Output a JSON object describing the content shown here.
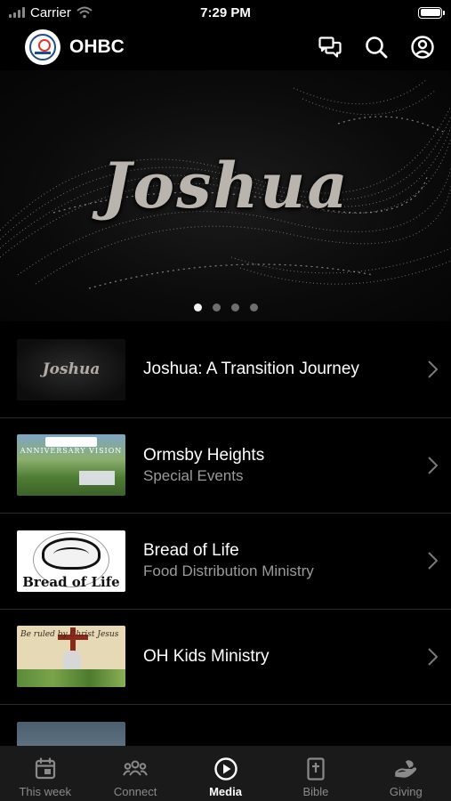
{
  "status_bar": {
    "carrier": "Carrier",
    "time": "7:29 PM"
  },
  "header": {
    "title": "OHBC",
    "icons": [
      "chat-icon",
      "search-icon",
      "profile-icon"
    ]
  },
  "hero": {
    "title": "Joshua",
    "page_count": 4,
    "active_page": 1
  },
  "media_list": [
    {
      "title": "Joshua: A Transition Journey",
      "subtitle": "",
      "thumb_text": "Joshua"
    },
    {
      "title": "Ormsby Heights",
      "subtitle": "Special Events",
      "thumb_text": "ANNIVERSARY VISION"
    },
    {
      "title": "Bread of Life",
      "subtitle": "Food Distribution Ministry",
      "thumb_text": "Bread of Life"
    },
    {
      "title": "OH Kids Ministry",
      "subtitle": "",
      "thumb_text": "Be ruled by Christ Jesus"
    }
  ],
  "tab_bar": {
    "tabs": [
      {
        "label": "This week",
        "icon": "calendar-icon",
        "active": false
      },
      {
        "label": "Connect",
        "icon": "people-icon",
        "active": false
      },
      {
        "label": "Media",
        "icon": "play-icon",
        "active": true
      },
      {
        "label": "Bible",
        "icon": "bible-icon",
        "active": false
      },
      {
        "label": "Giving",
        "icon": "giving-hand-icon",
        "active": false
      }
    ]
  },
  "colors": {
    "background": "#000000",
    "tab_bar_bg": "#1a1a1a",
    "text_primary": "#ffffff",
    "text_secondary": "#9b9b9b",
    "tab_inactive": "#8a8a8a",
    "separator": "#2b2b2b"
  }
}
